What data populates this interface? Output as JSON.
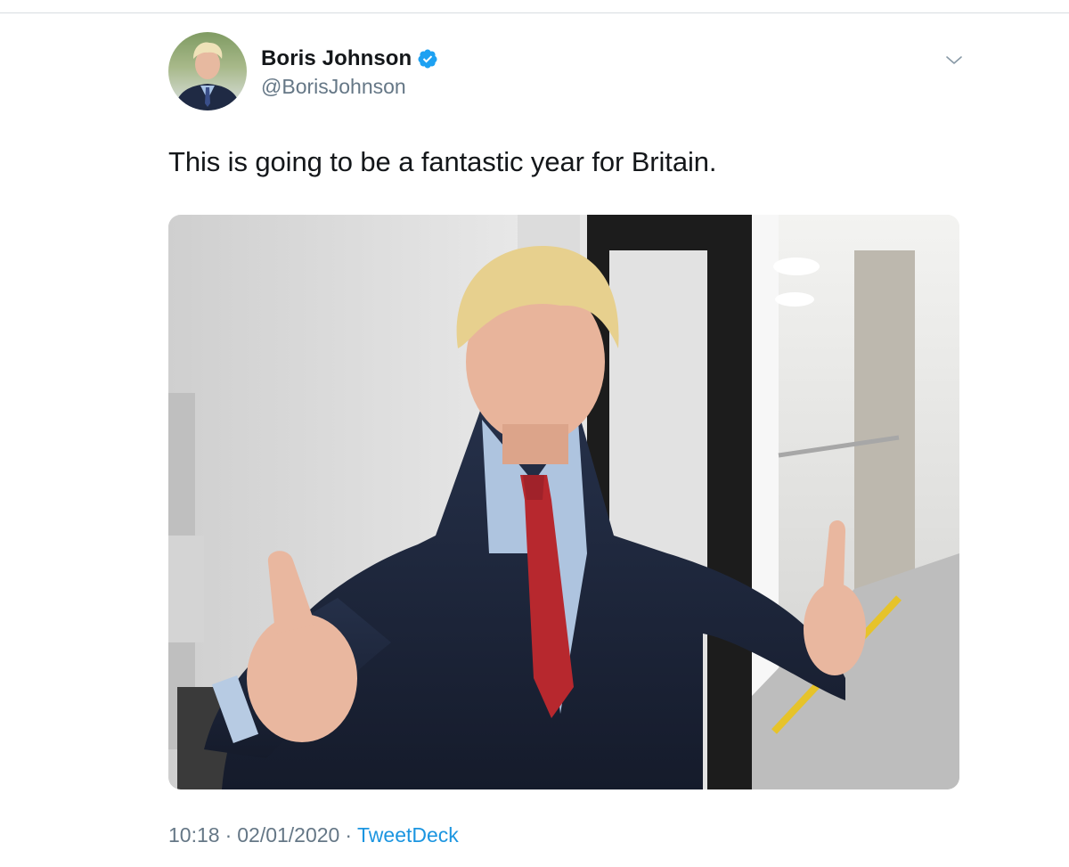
{
  "tweet": {
    "author": {
      "display_name": "Boris Johnson",
      "handle": "@BorisJohnson",
      "verified": true,
      "avatar_icon": "profile-photo"
    },
    "text": "This is going to be a fantastic year for Britain.",
    "media": {
      "type": "photo",
      "subject": "man in navy suit and red tie giving two thumbs up in a corridor"
    },
    "time": "10:18",
    "date": "02/01/2020",
    "separator": "·",
    "source": "TweetDeck",
    "menu_icon": "chevron-down-icon"
  },
  "colors": {
    "text": "#14171a",
    "secondary": "#657786",
    "link": "#1b95e0",
    "verified": "#1da1f2"
  }
}
